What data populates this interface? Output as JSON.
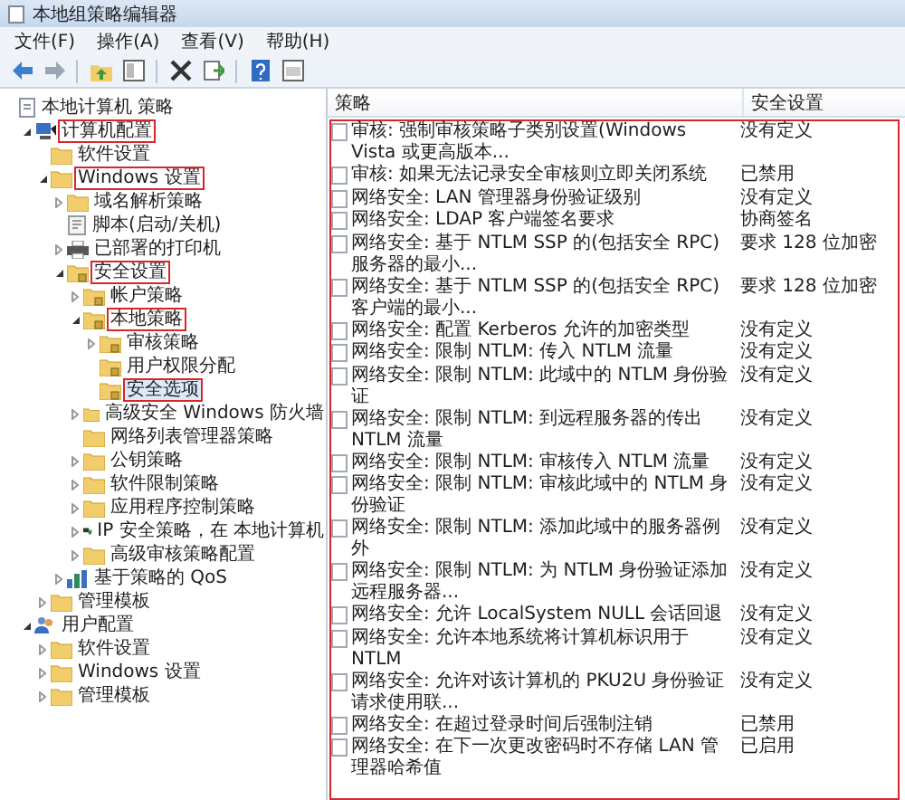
{
  "window": {
    "title": "本地组策略编辑器"
  },
  "menu": [
    "文件(F)",
    "操作(A)",
    "查看(V)",
    "帮助(H)"
  ],
  "tree": [
    {
      "label": "本地计算机 策略",
      "kind": "policy",
      "marked": false,
      "selected": false,
      "children": [
        {
          "label": "计算机配置",
          "kind": "computer",
          "expanded": true,
          "marked": true,
          "selected": false,
          "children": [
            {
              "label": "软件设置",
              "kind": "folder",
              "marked": false,
              "selected": false
            },
            {
              "label": "Windows 设置",
              "kind": "folder",
              "expanded": true,
              "marked": true,
              "selected": false,
              "children": [
                {
                  "label": "域名解析策略",
                  "kind": "folder",
                  "expanded": false,
                  "marked": false,
                  "selected": false
                },
                {
                  "label": "脚本(启动/关机)",
                  "kind": "script",
                  "marked": false,
                  "selected": false
                },
                {
                  "label": "已部署的打印机",
                  "kind": "printer",
                  "expanded": false,
                  "marked": false,
                  "selected": false
                },
                {
                  "label": "安全设置",
                  "kind": "secure",
                  "expanded": true,
                  "marked": true,
                  "selected": false,
                  "children": [
                    {
                      "label": "帐户策略",
                      "kind": "secure",
                      "expanded": false,
                      "marked": false,
                      "selected": false
                    },
                    {
                      "label": "本地策略",
                      "kind": "secure",
                      "expanded": true,
                      "marked": true,
                      "selected": false,
                      "children": [
                        {
                          "label": "审核策略",
                          "kind": "secure",
                          "expanded": false,
                          "marked": false,
                          "selected": false
                        },
                        {
                          "label": "用户权限分配",
                          "kind": "secure",
                          "marked": false,
                          "selected": false
                        },
                        {
                          "label": "安全选项",
                          "kind": "secure",
                          "marked": true,
                          "selected": true
                        }
                      ]
                    },
                    {
                      "label": "高级安全 Windows 防火墙",
                      "kind": "folder",
                      "expanded": false,
                      "marked": false,
                      "selected": false
                    },
                    {
                      "label": "网络列表管理器策略",
                      "kind": "folder",
                      "marked": false,
                      "selected": false
                    },
                    {
                      "label": "公钥策略",
                      "kind": "folder",
                      "expanded": false,
                      "marked": false,
                      "selected": false
                    },
                    {
                      "label": "软件限制策略",
                      "kind": "folder",
                      "expanded": false,
                      "marked": false,
                      "selected": false
                    },
                    {
                      "label": "应用程序控制策略",
                      "kind": "folder",
                      "expanded": false,
                      "marked": false,
                      "selected": false
                    },
                    {
                      "label": "IP 安全策略，在 本地计算机",
                      "kind": "network",
                      "expanded": false,
                      "marked": false,
                      "selected": false
                    },
                    {
                      "label": "高级审核策略配置",
                      "kind": "folder",
                      "expanded": false,
                      "marked": false,
                      "selected": false
                    }
                  ]
                },
                {
                  "label": "基于策略的 QoS",
                  "kind": "chart",
                  "expanded": false,
                  "marked": false,
                  "selected": false
                }
              ]
            },
            {
              "label": "管理模板",
              "kind": "folder",
              "expanded": false,
              "marked": false,
              "selected": false
            }
          ]
        },
        {
          "label": "用户配置",
          "kind": "user",
          "expanded": true,
          "marked": false,
          "selected": false,
          "children": [
            {
              "label": "软件设置",
              "kind": "folder",
              "expanded": false,
              "marked": false,
              "selected": false
            },
            {
              "label": "Windows 设置",
              "kind": "folder",
              "expanded": false,
              "marked": false,
              "selected": false
            },
            {
              "label": "管理模板",
              "kind": "folder",
              "expanded": false,
              "marked": false,
              "selected": false
            }
          ]
        }
      ]
    }
  ],
  "list": {
    "columns": [
      "策略",
      "安全设置"
    ],
    "annotated": true,
    "rows": [
      {
        "policy": "审核: 强制审核策略子类别设置(Windows Vista 或更高版本...",
        "setting": "没有定义",
        "selected": false
      },
      {
        "policy": "审核: 如果无法记录安全审核则立即关闭系统",
        "setting": "已禁用",
        "selected": false
      },
      {
        "policy": "网络安全: LAN 管理器身份验证级别",
        "setting": "没有定义",
        "selected": false
      },
      {
        "policy": "网络安全: LDAP 客户端签名要求",
        "setting": "协商签名",
        "selected": false
      },
      {
        "policy": "网络安全: 基于 NTLM SSP 的(包括安全 RPC)服务器的最小...",
        "setting": "要求 128 位加密",
        "selected": false
      },
      {
        "policy": "网络安全: 基于 NTLM SSP 的(包括安全 RPC)客户端的最小...",
        "setting": "要求 128 位加密",
        "selected": false
      },
      {
        "policy": "网络安全: 配置 Kerberos 允许的加密类型",
        "setting": "没有定义",
        "selected": false
      },
      {
        "policy": "网络安全: 限制 NTLM: 传入 NTLM 流量",
        "setting": "没有定义",
        "selected": false
      },
      {
        "policy": "网络安全: 限制 NTLM: 此域中的 NTLM 身份验证",
        "setting": "没有定义",
        "selected": false
      },
      {
        "policy": "网络安全: 限制 NTLM: 到远程服务器的传出 NTLM 流量",
        "setting": "没有定义",
        "selected": false
      },
      {
        "policy": "网络安全: 限制 NTLM: 审核传入 NTLM 流量",
        "setting": "没有定义",
        "selected": false
      },
      {
        "policy": "网络安全: 限制 NTLM: 审核此域中的 NTLM 身份验证",
        "setting": "没有定义",
        "selected": false
      },
      {
        "policy": "网络安全: 限制 NTLM: 添加此域中的服务器例外",
        "setting": "没有定义",
        "selected": false
      },
      {
        "policy": "网络安全: 限制 NTLM: 为 NTLM 身份验证添加远程服务器...",
        "setting": "没有定义",
        "selected": false
      },
      {
        "policy": "网络安全: 允许 LocalSystem NULL 会话回退",
        "setting": "没有定义",
        "selected": false
      },
      {
        "policy": "网络安全: 允许本地系统将计算机标识用于 NTLM",
        "setting": "没有定义",
        "selected": false
      },
      {
        "policy": "网络安全: 允许对该计算机的 PKU2U 身份验证请求使用联...",
        "setting": "没有定义",
        "selected": false
      },
      {
        "policy": "网络安全: 在超过登录时间后强制注销",
        "setting": "已禁用",
        "selected": false
      },
      {
        "policy": "网络安全: 在下一次更改密码时不存储 LAN 管理器哈希值",
        "setting": "已启用",
        "selected": false
      }
    ]
  }
}
